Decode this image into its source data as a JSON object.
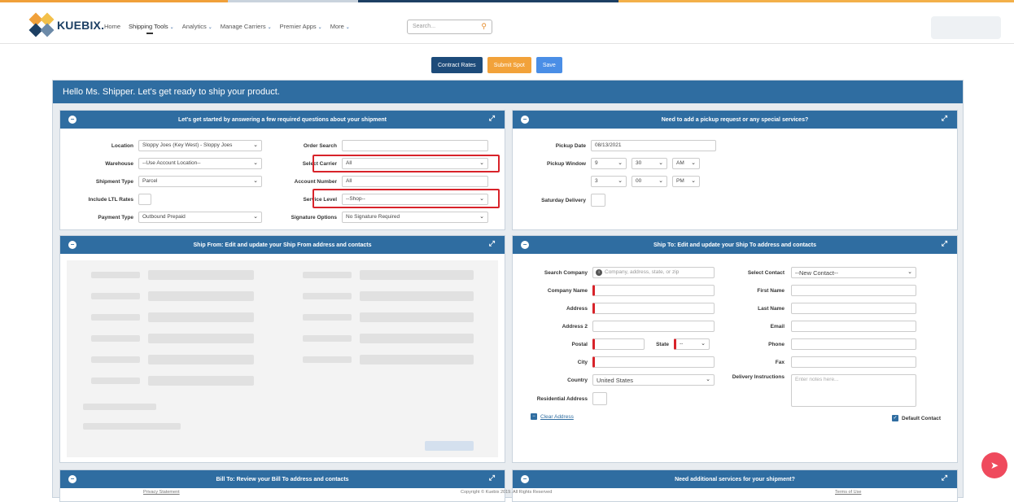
{
  "nav": {
    "logo_text": "KUEBIX.",
    "links": [
      {
        "label": "Home"
      },
      {
        "label": "Shipping Tools",
        "caret": "⌄"
      },
      {
        "label": "Analytics",
        "caret": "⌄"
      },
      {
        "label": "Manage Carriers",
        "caret": "⌄"
      },
      {
        "label": "Premier Apps",
        "caret": "⌄"
      },
      {
        "label": "More",
        "caret": "⌄"
      }
    ],
    "search_placeholder": "Search..."
  },
  "actions": {
    "contract_rates": "Contract Rates",
    "submit_spot": "Submit Spot",
    "save": "Save"
  },
  "main": {
    "greeting": "Hello Ms. Shipper. Let's get ready to ship your product."
  },
  "shipment_card": {
    "title": "Let's get started by answering a few required questions about your shipment",
    "location_label": "Location",
    "location_value": "Sloppy Joes (Key West) - Sloppy Joes",
    "warehouse_label": "Warehouse",
    "warehouse_value": "--Use Account Location--",
    "shipment_type_label": "Shipment Type",
    "shipment_type_value": "Parcel",
    "include_ltl_label": "Include LTL Rates",
    "payment_type_label": "Payment Type",
    "payment_type_value": "Outbound Prepaid",
    "order_search_label": "Order Search",
    "select_carrier_label": "Select Carrier",
    "select_carrier_value": "All",
    "account_number_label": "Account Number",
    "account_number_value": "All",
    "service_level_label": "Service Level",
    "service_level_value": "--Shop--",
    "signature_label": "Signature Options",
    "signature_value": "No Signature Required"
  },
  "pickup_card": {
    "title": "Need to add a pickup request or any special services?",
    "pickup_date_label": "Pickup Date",
    "pickup_date_value": "08/13/2021",
    "pickup_window_label": "Pickup Window",
    "window_start": {
      "hour": "9",
      "minute": "30",
      "ampm": "AM"
    },
    "window_end": {
      "hour": "3",
      "minute": "00",
      "ampm": "PM"
    },
    "saturday_label": "Saturday Delivery"
  },
  "shipfrom_card": {
    "title": "Ship From: Edit and update your Ship From address and contacts"
  },
  "shipto_card": {
    "title": "Ship To: Edit and update your Ship To address and contacts",
    "search_company_label": "Search Company",
    "search_company_placeholder": "Company, address, state, or zip",
    "company_name_label": "Company Name",
    "address_label": "Address",
    "address2_label": "Address 2",
    "postal_label": "Postal",
    "state_label": "State",
    "state_value": "--",
    "city_label": "City",
    "country_label": "Country",
    "country_value": "United States",
    "residential_label": "Residential Address",
    "clear_address": "Clear Address",
    "select_contact_label": "Select Contact",
    "select_contact_value": "--New Contact--",
    "first_name_label": "First Name",
    "last_name_label": "Last Name",
    "email_label": "Email",
    "phone_label": "Phone",
    "fax_label": "Fax",
    "delivery_instr_label": "Delivery Instructions",
    "delivery_instr_placeholder": "Enter notes here...",
    "default_contact_label": "Default Contact"
  },
  "billto_card": {
    "title": "Bill To: Review your Bill To address and contacts"
  },
  "services_card": {
    "title": "Need additional services for your shipment?"
  },
  "footer": {
    "privacy": "Privacy Statement",
    "copyright": "Copyright © Kuebix 2019. All Rights Reserved",
    "terms": "Terms of Use"
  }
}
